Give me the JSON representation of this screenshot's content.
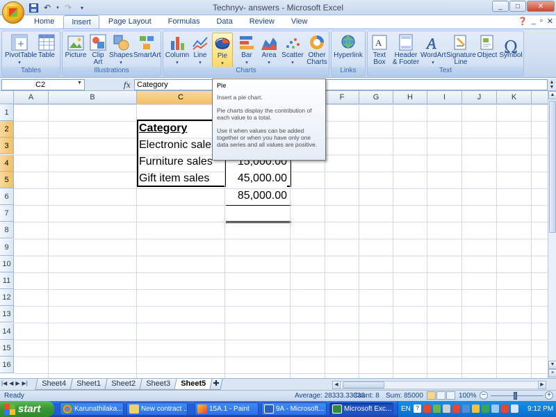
{
  "window": {
    "title": "Technyv- answers - Microsoft Excel",
    "controls": [
      "_",
      "□",
      "✕"
    ]
  },
  "qat": {
    "save_icon": "save-icon",
    "undo_icon": "undo-icon",
    "redo_icon": "redo-icon"
  },
  "tabs": [
    {
      "label": "Home",
      "active": false
    },
    {
      "label": "Insert",
      "active": true
    },
    {
      "label": "Page Layout",
      "active": false
    },
    {
      "label": "Formulas",
      "active": false
    },
    {
      "label": "Data",
      "active": false
    },
    {
      "label": "Review",
      "active": false
    },
    {
      "label": "View",
      "active": false
    }
  ],
  "ribbon": {
    "groups": {
      "tables": {
        "label": "Tables",
        "pivot": "PivotTable",
        "table": "Table"
      },
      "illustrations": {
        "label": "Illustrations",
        "picture": "Picture",
        "clipart": "Clip Art",
        "shapes": "Shapes",
        "smartart": "SmartArt"
      },
      "charts": {
        "label": "Charts",
        "column": "Column",
        "line": "Line",
        "pie": "Pie",
        "bar": "Bar",
        "area": "Area",
        "scatter": "Scatter",
        "other": "Other Charts"
      },
      "links": {
        "label": "Links",
        "hyperlink": "Hyperlink"
      },
      "text": {
        "label": "Text",
        "textbox": "Text Box",
        "header": "Header & Footer",
        "wordart": "WordArt",
        "signature": "Signature Line",
        "object": "Object",
        "symbol": "Symbol"
      }
    }
  },
  "formula_bar": {
    "name_box": "C2",
    "fx": "fx",
    "content": "Category"
  },
  "grid": {
    "columns": [
      "A",
      "B",
      "C",
      "D",
      "E",
      "F",
      "G",
      "H",
      "I",
      "J",
      "K"
    ],
    "selected_column": "C",
    "rows": [
      "1",
      "2",
      "3",
      "4",
      "5",
      "6",
      "7",
      "8",
      "9",
      "10",
      "11",
      "12",
      "13",
      "14",
      "15",
      "16"
    ],
    "selected_rows": [
      "2",
      "3",
      "4",
      "5"
    ],
    "cells": {
      "c2": "Category",
      "c3": "Electronic sales",
      "c4": "Furniture sales",
      "c5": "Gift item sales",
      "d4": "15,000.00",
      "d5": "45,000.00",
      "d6": "85,000.00"
    }
  },
  "tooltip": {
    "title": "Pie",
    "line1": "Insert a pie chart.",
    "line2": "Pie charts display the contribution of each value to a total.",
    "line3": "Use it when values can be added together or when you have only one data series and all values are positive."
  },
  "sheets": [
    {
      "label": "Sheet4",
      "active": false
    },
    {
      "label": "Sheet1",
      "active": false
    },
    {
      "label": "Sheet2",
      "active": false
    },
    {
      "label": "Sheet3",
      "active": false
    },
    {
      "label": "Sheet5",
      "active": true
    }
  ],
  "status": {
    "ready": "Ready",
    "average": "Average: 28333.33333",
    "count": "Count: 8",
    "sum": "Sum: 85000",
    "zoom": "100%"
  },
  "taskbar": {
    "start": "start",
    "tasks": [
      "Karunathilaka...",
      "New contract ...",
      "15A.1 - Paint",
      "9A - Microsoft...",
      "Microsoft Exc..."
    ],
    "lang": "EN",
    "clock": "9:12 PM"
  }
}
